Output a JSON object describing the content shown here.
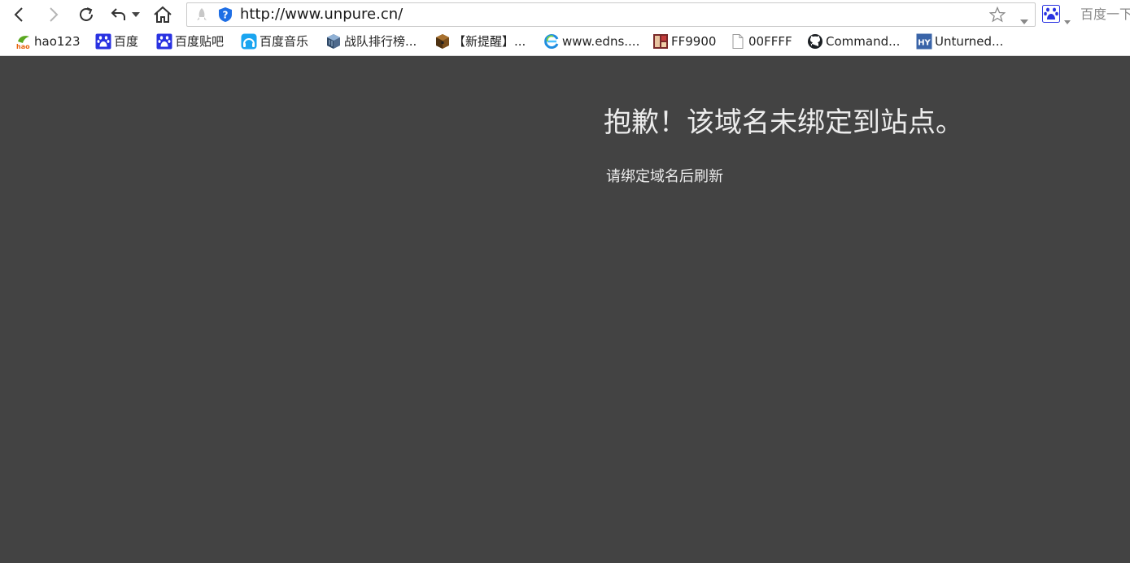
{
  "address_bar": {
    "url": "http://www.unpure.cn/"
  },
  "search": {
    "placeholder": "百度一下"
  },
  "bookmarks": [
    {
      "label": "hao123",
      "icon": "hao123-icon"
    },
    {
      "label": "百度",
      "icon": "baidu-paw-icon"
    },
    {
      "label": "百度贴吧",
      "icon": "baidu-paw-icon"
    },
    {
      "label": "百度音乐",
      "icon": "music-icon"
    },
    {
      "label": "战队排行榜...",
      "icon": "minecraft-block-icon"
    },
    {
      "label": "【新提醒】...",
      "icon": "minecraft-chest-icon"
    },
    {
      "label": "www.edns....",
      "icon": "edge-e-icon"
    },
    {
      "label": "FF9900",
      "icon": "ff9900-site-icon"
    },
    {
      "label": "00FFFF",
      "icon": "blank-page-icon"
    },
    {
      "label": "Command...",
      "icon": "github-icon"
    },
    {
      "label": "Unturned...",
      "icon": "hy-icon"
    }
  ],
  "page": {
    "title": "抱歉！该域名未绑定到站点。",
    "subtitle": "请绑定域名后刷新"
  },
  "colors": {
    "page_background": "#434343",
    "page_text": "#ececec",
    "shield_blue": "#1f6fe5",
    "baidu_blue": "#2932e1"
  }
}
